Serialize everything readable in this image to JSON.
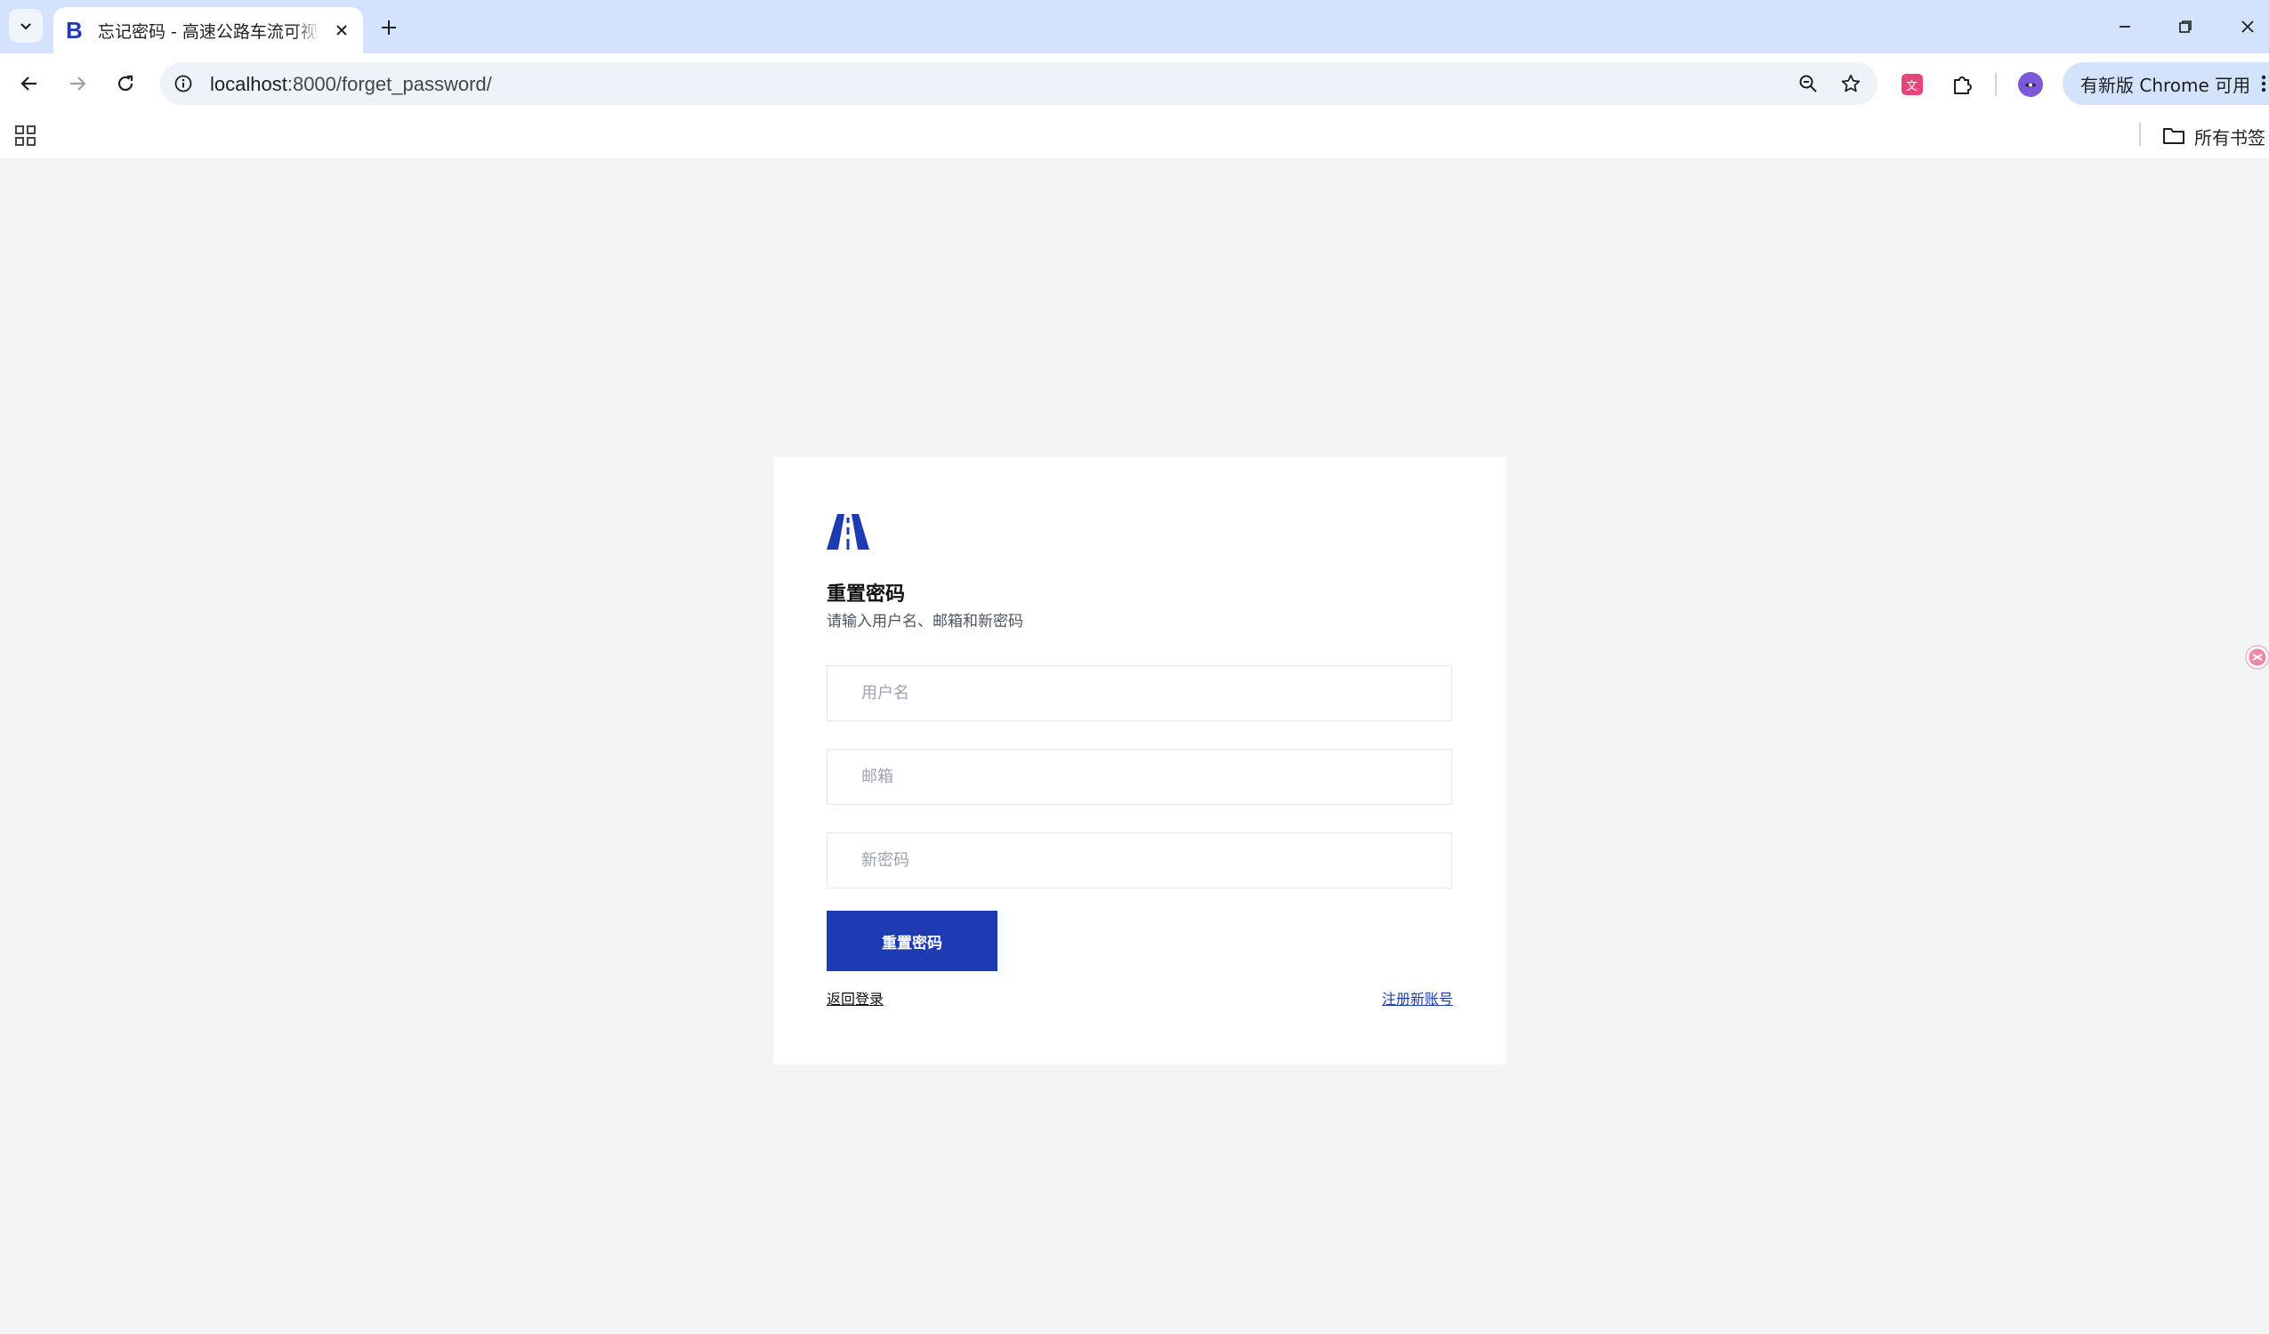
{
  "browser": {
    "tab_title": "忘记密码 - 高速公路车流可视化",
    "url_host": "localhost",
    "url_rest": ":8000/forget_password/",
    "update_label": "有新版 Chrome 可用",
    "bookmark_folder": "所有书签",
    "favicon_letter": "B"
  },
  "form": {
    "title": "重置密码",
    "subtitle": "请输入用户名、邮箱和新密码",
    "username_placeholder": "用户名",
    "email_placeholder": "邮箱",
    "password_placeholder": "新密码",
    "submit_label": "重置密码",
    "back_link": "返回登录",
    "register_link": "注册新账号"
  },
  "colors": {
    "brand": "#1e3bb3",
    "page_bg": "#f3f4f6",
    "tabstrip_bg": "#d3e3fd"
  }
}
